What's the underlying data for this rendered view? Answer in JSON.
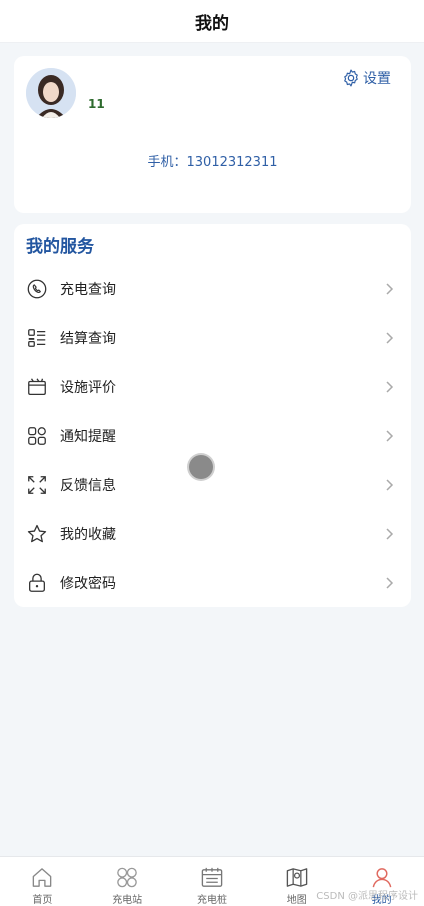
{
  "header": {
    "title": "我的"
  },
  "profile": {
    "username": "11",
    "settings_label": "设置",
    "phone_text": "手机：13012312311"
  },
  "services": {
    "title": "我的服务",
    "items": [
      {
        "label": "充电查询",
        "icon": "phone-icon"
      },
      {
        "label": "结算查询",
        "icon": "list-icon"
      },
      {
        "label": "设施评价",
        "icon": "folder-icon"
      },
      {
        "label": "通知提醒",
        "icon": "apps-icon"
      },
      {
        "label": "反馈信息",
        "icon": "fullscreen-icon"
      },
      {
        "label": "我的收藏",
        "icon": "star-icon"
      },
      {
        "label": "修改密码",
        "icon": "lock-icon"
      }
    ]
  },
  "bottom_nav": {
    "items": [
      {
        "label": "首页",
        "icon": "home-icon"
      },
      {
        "label": "充电站",
        "icon": "station-icon"
      },
      {
        "label": "充电桩",
        "icon": "pile-icon"
      },
      {
        "label": "地图",
        "icon": "map-icon"
      },
      {
        "label": "我的",
        "icon": "user-icon",
        "active": true
      }
    ]
  },
  "watermark": "CSDN @派思程序设计",
  "colors": {
    "accent": "#2356a0",
    "active_nav": "#e0695f",
    "background": "#f3f6f9"
  }
}
